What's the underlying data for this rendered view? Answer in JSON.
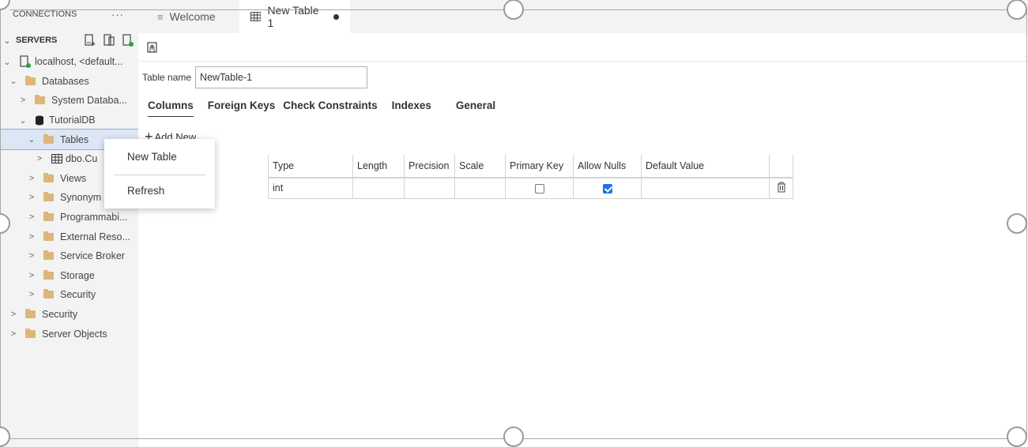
{
  "sidebar": {
    "header": "CONNECTIONS",
    "more": "···",
    "servers_title": "SERVERS",
    "tree": [
      {
        "label": "localhost, <default...",
        "chevron": "⌄",
        "icon": "server"
      },
      {
        "label": "Databases",
        "chevron": "⌄",
        "icon": "folder"
      },
      {
        "label": "System Databa...",
        "chevron": ">",
        "icon": "folder"
      },
      {
        "label": "TutorialDB",
        "chevron": "⌄",
        "icon": "database"
      },
      {
        "label": "Tables",
        "chevron": "⌄",
        "icon": "folder"
      },
      {
        "label": "dbo.Cu",
        "chevron": ">",
        "icon": "table"
      },
      {
        "label": "Views",
        "chevron": ">",
        "icon": "folder"
      },
      {
        "label": "Synonym",
        "chevron": ">",
        "icon": "folder"
      },
      {
        "label": "Programmabi...",
        "chevron": ">",
        "icon": "folder"
      },
      {
        "label": "External Reso...",
        "chevron": ">",
        "icon": "folder"
      },
      {
        "label": "Service Broker",
        "chevron": ">",
        "icon": "folder"
      },
      {
        "label": "Storage",
        "chevron": ">",
        "icon": "folder"
      },
      {
        "label": "Security",
        "chevron": ">",
        "icon": "folder"
      },
      {
        "label": "Security",
        "chevron": ">",
        "icon": "folder"
      },
      {
        "label": "Server Objects",
        "chevron": ">",
        "icon": "folder"
      }
    ]
  },
  "tabs": {
    "welcome": "Welcome",
    "new_table": "New Table 1"
  },
  "editor": {
    "table_name_label": "Table name",
    "table_name_value": "NewTable-1",
    "designer_tabs": [
      "Columns",
      "Foreign Keys",
      "Check Constraints",
      "Indexes",
      "General"
    ],
    "add_new": "Add New",
    "grid": {
      "headers": [
        "Type",
        "Length",
        "Precision",
        "Scale",
        "Primary Key",
        "Allow Nulls",
        "Default Value"
      ],
      "row": {
        "type": "int",
        "length": "",
        "precision": "",
        "scale": "",
        "primary_key": false,
        "allow_nulls": true,
        "default_value": ""
      }
    }
  },
  "context_menu": {
    "items": [
      "New Table",
      "Refresh"
    ]
  },
  "colors": {
    "accent": "#1a73e8",
    "folder": "#dcb67a",
    "sidebar_bg": "#f3f3f3",
    "selection": "#dce6f4",
    "status_green": "#2ea043"
  }
}
